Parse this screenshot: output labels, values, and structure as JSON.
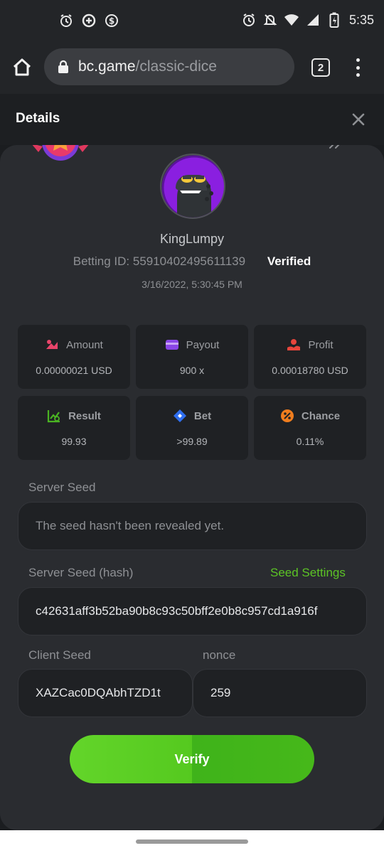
{
  "status_bar": {
    "time": "5:35",
    "left_icons": [
      "alarm-icon",
      "data-saver-icon",
      "dollar-circle-icon"
    ],
    "right_icons": [
      "alarm-icon",
      "notifications-off-icon",
      "wifi-icon",
      "signal-icon",
      "battery-icon"
    ]
  },
  "browser": {
    "url_host": "bc.game",
    "url_path": "/classic-dice",
    "tab_count": "2"
  },
  "dialog": {
    "title": "Details"
  },
  "bet": {
    "username": "KingLumpy",
    "betting_id": "Betting ID: 55910402495611139",
    "verified": "Verified",
    "date": "3/16/2022, 5:30:45 PM"
  },
  "stats": [
    {
      "label": "Amount",
      "value": "0.00000021 USD",
      "icon": "amount-icon",
      "color": "#e8456a"
    },
    {
      "label": "Payout",
      "value": "900 x",
      "icon": "wallet-icon",
      "color": "#8a46e6"
    },
    {
      "label": "Profit",
      "value": "0.00018780 USD",
      "icon": "profit-icon",
      "color": "#e8463c"
    },
    {
      "label": "Result",
      "value": "99.93",
      "icon": "result-chart-icon",
      "color": "#4ab322"
    },
    {
      "label": "Bet",
      "value": ">99.89",
      "icon": "bet-icon",
      "color": "#2f6ff0"
    },
    {
      "label": "Chance",
      "value": "0.11%",
      "icon": "percent-icon",
      "color": "#f07d1e"
    }
  ],
  "server_seed": {
    "label": "Server Seed",
    "placeholder": "The seed hasn't been revealed yet."
  },
  "server_seed_hash": {
    "label": "Server Seed (hash)",
    "link": "Seed Settings",
    "value": "c42631aff3b52ba90b8c93c50bff2e0b8c957cd1a916f"
  },
  "client_seed": {
    "label": "Client Seed",
    "value": "XAZCac0DQAbhTZD1t"
  },
  "nonce": {
    "label": "nonce",
    "value": "259"
  },
  "verify_label": "Verify"
}
